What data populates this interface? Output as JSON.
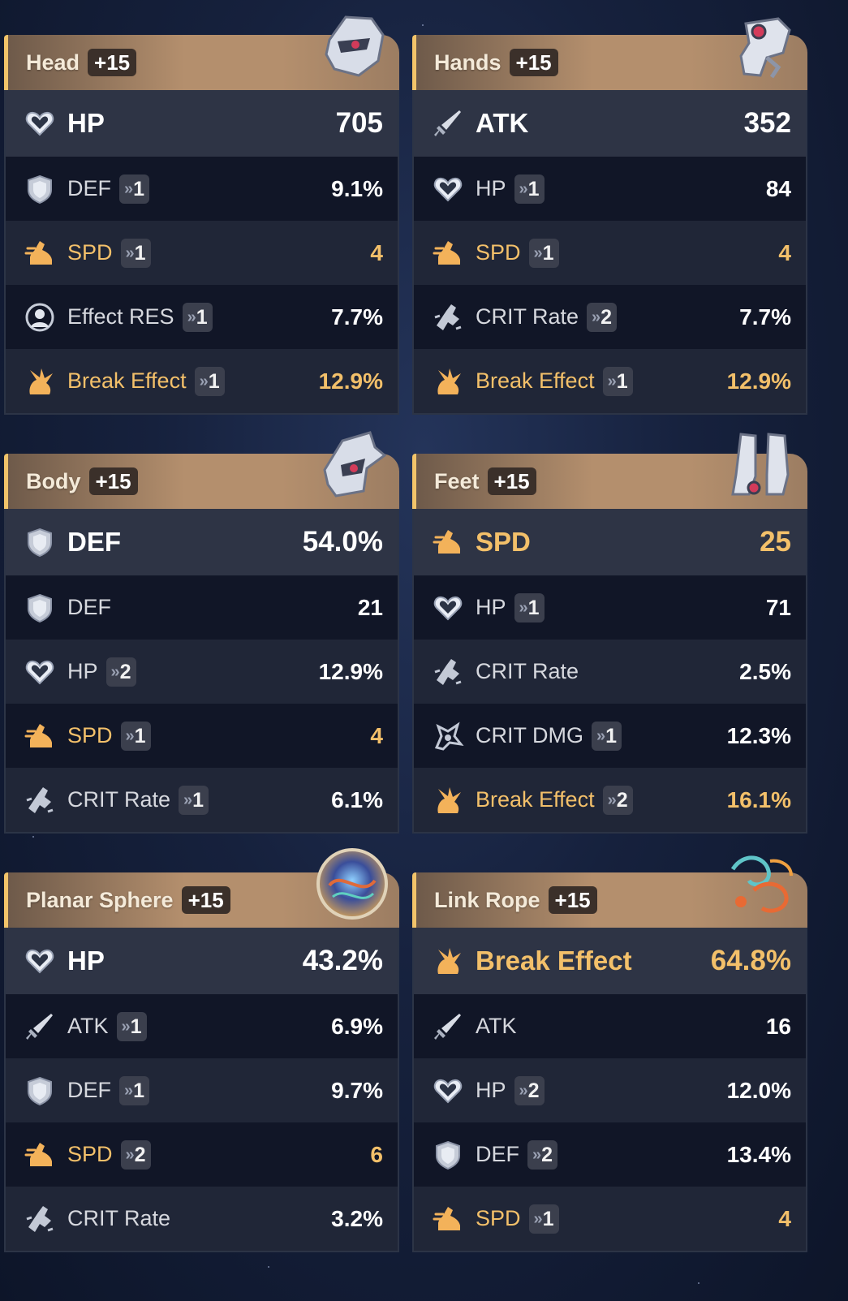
{
  "colors": {
    "gold": "#f3c06a",
    "header": "#b48f6d",
    "accent_bar": "#f2c46a"
  },
  "panels": [
    {
      "slot": "Head",
      "level": "+15",
      "icon": "head-relic-icon",
      "main": {
        "stat": "HP",
        "value": "705",
        "icon": "hp-heart-icon",
        "gold": false
      },
      "subs": [
        {
          "stat": "DEF",
          "roll": "1",
          "value": "9.1%",
          "icon": "def-shield-icon",
          "gold": false
        },
        {
          "stat": "SPD",
          "roll": "1",
          "value": "4",
          "icon": "spd-boot-icon",
          "gold": true
        },
        {
          "stat": "Effect RES",
          "roll": "1",
          "value": "7.7%",
          "icon": "effect-res-icon",
          "gold": false
        },
        {
          "stat": "Break Effect",
          "roll": "1",
          "value": "12.9%",
          "icon": "break-effect-icon",
          "gold": true
        }
      ]
    },
    {
      "slot": "Hands",
      "level": "+15",
      "icon": "hands-relic-icon",
      "main": {
        "stat": "ATK",
        "value": "352",
        "icon": "atk-sword-icon",
        "gold": false
      },
      "subs": [
        {
          "stat": "HP",
          "roll": "1",
          "value": "84",
          "icon": "hp-heart-icon",
          "gold": false
        },
        {
          "stat": "SPD",
          "roll": "1",
          "value": "4",
          "icon": "spd-boot-icon",
          "gold": true
        },
        {
          "stat": "CRIT Rate",
          "roll": "2",
          "value": "7.7%",
          "icon": "crit-rate-icon",
          "gold": false
        },
        {
          "stat": "Break Effect",
          "roll": "1",
          "value": "12.9%",
          "icon": "break-effect-icon",
          "gold": true
        }
      ]
    },
    {
      "slot": "Body",
      "level": "+15",
      "icon": "body-relic-icon",
      "main": {
        "stat": "DEF",
        "value": "54.0%",
        "icon": "def-shield-icon",
        "gold": false
      },
      "subs": [
        {
          "stat": "DEF",
          "roll": "",
          "value": "21",
          "icon": "def-shield-icon",
          "gold": false
        },
        {
          "stat": "HP",
          "roll": "2",
          "value": "12.9%",
          "icon": "hp-heart-icon",
          "gold": false
        },
        {
          "stat": "SPD",
          "roll": "1",
          "value": "4",
          "icon": "spd-boot-icon",
          "gold": true
        },
        {
          "stat": "CRIT Rate",
          "roll": "1",
          "value": "6.1%",
          "icon": "crit-rate-icon",
          "gold": false
        }
      ]
    },
    {
      "slot": "Feet",
      "level": "+15",
      "icon": "feet-relic-icon",
      "main": {
        "stat": "SPD",
        "value": "25",
        "icon": "spd-boot-icon",
        "gold": true
      },
      "subs": [
        {
          "stat": "HP",
          "roll": "1",
          "value": "71",
          "icon": "hp-heart-icon",
          "gold": false
        },
        {
          "stat": "CRIT Rate",
          "roll": "",
          "value": "2.5%",
          "icon": "crit-rate-icon",
          "gold": false
        },
        {
          "stat": "CRIT DMG",
          "roll": "1",
          "value": "12.3%",
          "icon": "crit-dmg-icon",
          "gold": false
        },
        {
          "stat": "Break Effect",
          "roll": "2",
          "value": "16.1%",
          "icon": "break-effect-icon",
          "gold": true
        }
      ]
    },
    {
      "slot": "Planar Sphere",
      "level": "+15",
      "icon": "planar-sphere-icon",
      "main": {
        "stat": "HP",
        "value": "43.2%",
        "icon": "hp-heart-icon",
        "gold": false
      },
      "subs": [
        {
          "stat": "ATK",
          "roll": "1",
          "value": "6.9%",
          "icon": "atk-sword-icon",
          "gold": false
        },
        {
          "stat": "DEF",
          "roll": "1",
          "value": "9.7%",
          "icon": "def-shield-icon",
          "gold": false
        },
        {
          "stat": "SPD",
          "roll": "2",
          "value": "6",
          "icon": "spd-boot-icon",
          "gold": true
        },
        {
          "stat": "CRIT Rate",
          "roll": "",
          "value": "3.2%",
          "icon": "crit-rate-icon",
          "gold": false
        }
      ]
    },
    {
      "slot": "Link Rope",
      "level": "+15",
      "icon": "link-rope-icon",
      "main": {
        "stat": "Break Effect",
        "value": "64.8%",
        "icon": "break-effect-icon",
        "gold": true
      },
      "subs": [
        {
          "stat": "ATK",
          "roll": "",
          "value": "16",
          "icon": "atk-sword-icon",
          "gold": false
        },
        {
          "stat": "HP",
          "roll": "2",
          "value": "12.0%",
          "icon": "hp-heart-icon",
          "gold": false
        },
        {
          "stat": "DEF",
          "roll": "2",
          "value": "13.4%",
          "icon": "def-shield-icon",
          "gold": false
        },
        {
          "stat": "SPD",
          "roll": "1",
          "value": "4",
          "icon": "spd-boot-icon",
          "gold": true
        }
      ]
    }
  ]
}
